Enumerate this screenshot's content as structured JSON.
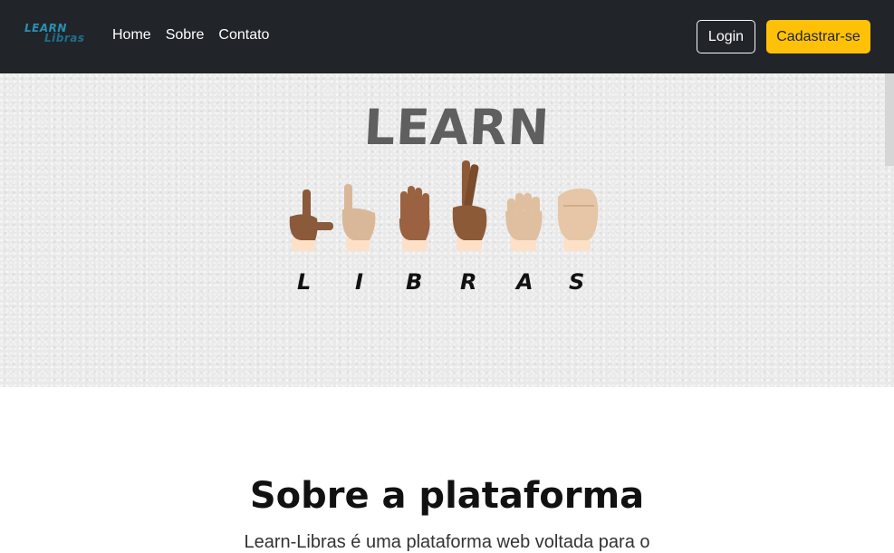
{
  "navbar": {
    "brand_line1": "LEARN",
    "brand_line2": "Libras",
    "links": [
      "Home",
      "Sobre",
      "Contato"
    ],
    "login_label": "Login",
    "signup_label": "Cadastrar-se"
  },
  "hero": {
    "title": "LEARN",
    "letters": [
      "L",
      "I",
      "B",
      "R",
      "A",
      "S"
    ]
  },
  "about": {
    "title": "Sobre a plataforma",
    "text": "Learn-Libras é uma plataforma web voltada para o"
  },
  "colors": {
    "navbar_bg": "#212529",
    "accent": "#ffc107",
    "brand": "#2b8fb0"
  }
}
